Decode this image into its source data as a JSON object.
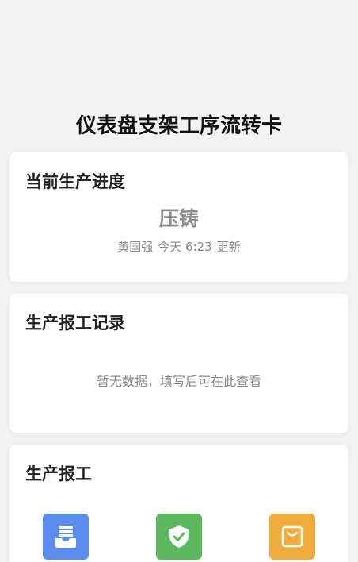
{
  "page": {
    "title": "仪表盘支架工序流转卡"
  },
  "progress": {
    "title": "当前生产进度",
    "stage": "压铸",
    "operator": "黄国强",
    "time": "今天 6:23",
    "suffix": "更新"
  },
  "records": {
    "title": "生产报工记录",
    "empty_text": "暂无数据，填写后可在此查看"
  },
  "report": {
    "title": "生产报工",
    "actions": [
      {
        "icon": "inbox-tray-icon",
        "color": "#5b8def"
      },
      {
        "icon": "shield-check-icon",
        "color": "#5cb85c"
      },
      {
        "icon": "shopping-bag-icon",
        "color": "#f0ad3e"
      }
    ]
  }
}
